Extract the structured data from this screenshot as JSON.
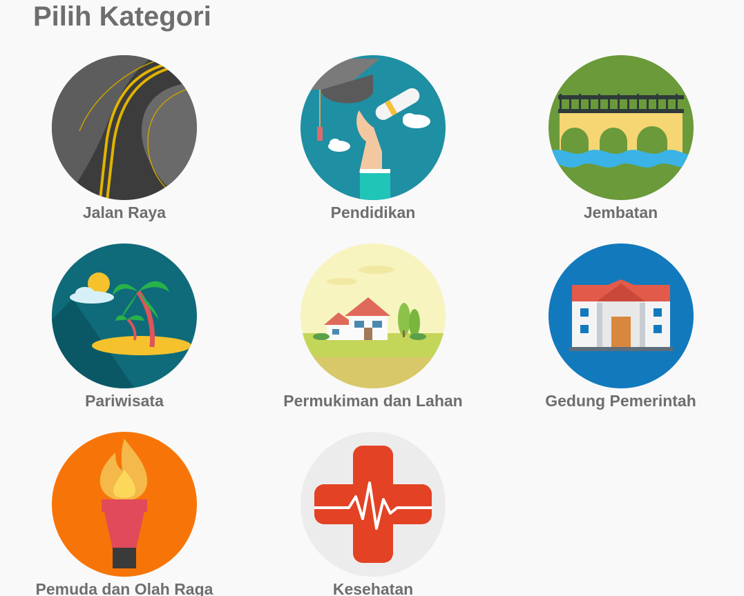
{
  "header": {
    "title": "Pilih Kategori"
  },
  "categories": [
    {
      "label": "Jalan Raya",
      "icon": "road-icon",
      "color": "#4a4a4a"
    },
    {
      "label": "Pendidikan",
      "icon": "graduation-icon",
      "color": "#1f8fa3"
    },
    {
      "label": "Jembatan",
      "icon": "bridge-icon",
      "color": "#6a9a3a"
    },
    {
      "label": "Pariwisata",
      "icon": "beach-icon",
      "color": "#0f6b7a"
    },
    {
      "label": "Permukiman dan Lahan",
      "icon": "house-icon",
      "color": "#f3f1b8"
    },
    {
      "label": "Gedung Pemerintah",
      "icon": "government-building-icon",
      "color": "#1279bd"
    },
    {
      "label": "Pemuda dan Olah Raga",
      "icon": "torch-icon",
      "color": "#f77508"
    },
    {
      "label": "Kesehatan",
      "icon": "medical-cross-icon",
      "color": "#ececec"
    }
  ]
}
